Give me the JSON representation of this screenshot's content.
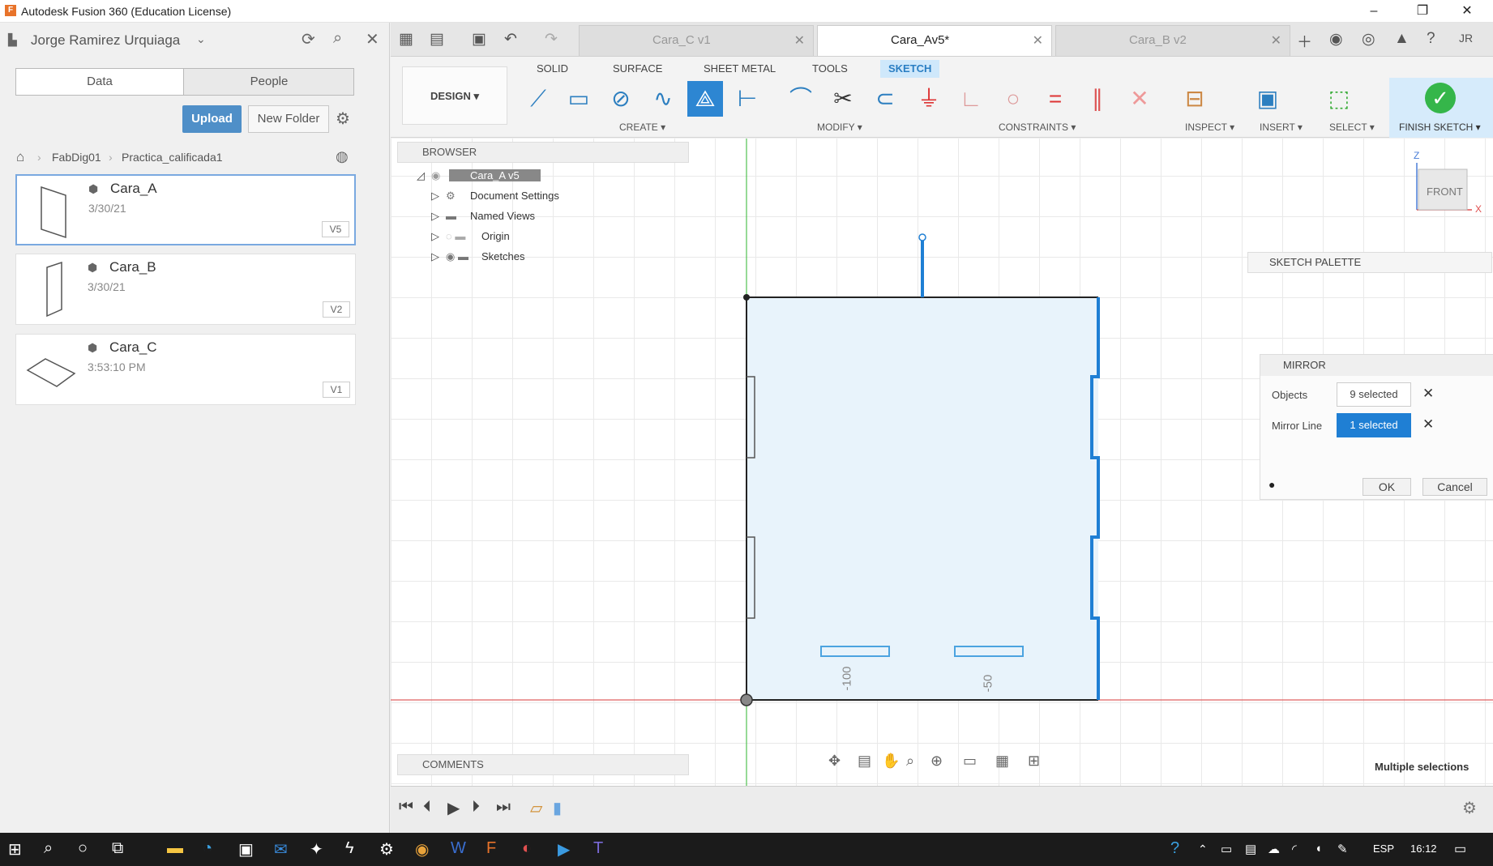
{
  "window": {
    "title": "Autodesk Fusion 360 (Education License)"
  },
  "data_panel": {
    "user": "Jorge Ramirez Urquiaga",
    "tabs": [
      "Data",
      "People"
    ],
    "upload_label": "Upload",
    "new_folder_label": "New Folder",
    "breadcrumb": [
      "FabDig01",
      "Practica_calificada1"
    ],
    "files": [
      {
        "name": "Cara_A",
        "date": "3/30/21",
        "version": "V5"
      },
      {
        "name": "Cara_B",
        "date": "3/30/21",
        "version": "V2"
      },
      {
        "name": "Cara_C",
        "date": "3:53:10 PM",
        "version": "V1"
      }
    ]
  },
  "doc_tabs": [
    {
      "label": "Cara_C v1",
      "active": false
    },
    {
      "label": "Cara_Av5*",
      "active": true
    },
    {
      "label": "Cara_B v2",
      "active": false
    }
  ],
  "workspace": {
    "label": "DESIGN ▾"
  },
  "ribbon_tabs": [
    "SOLID",
    "SURFACE",
    "SHEET METAL",
    "TOOLS",
    "SKETCH"
  ],
  "ribbon_groups": [
    "CREATE ▾",
    "MODIFY ▾",
    "CONSTRAINTS ▾",
    "INSPECT ▾",
    "INSERT ▾",
    "SELECT ▾",
    "FINISH SKETCH ▾"
  ],
  "browser": {
    "title": "BROWSER",
    "root": "Cara_A v5",
    "items": [
      "Document Settings",
      "Named Views",
      "Origin",
      "Sketches"
    ]
  },
  "comments_label": "COMMENTS",
  "sketch_palette_label": "SKETCH PALETTE",
  "mirror": {
    "title": "MIRROR",
    "objects_label": "Objects",
    "objects_value": "9 selected",
    "mirror_line_label": "Mirror Line",
    "mirror_line_value": "1 selected",
    "ok_label": "OK",
    "cancel_label": "Cancel"
  },
  "viewcube": {
    "face": "FRONT",
    "axis_z": "Z",
    "axis_x": "X"
  },
  "ruler": {
    "a": "-100",
    "b": "-50"
  },
  "status": "Multiple selections",
  "taskbar": {
    "lang": "ESP",
    "time": "16:12"
  },
  "colors": {
    "accent": "#2d86d2",
    "finish": "#35b64a",
    "sketch_fill": "#e8f3fb",
    "sketch_line": "#1f7fd4"
  }
}
